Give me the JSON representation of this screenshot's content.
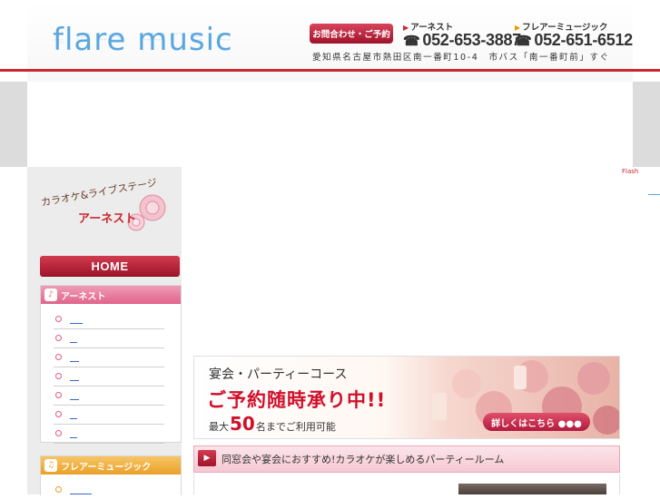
{
  "header": {
    "logo": "flare music",
    "contact_button": "お問合わせ・ご予約",
    "shops": [
      {
        "name": "アーネスト",
        "phone": "052-653-3887"
      },
      {
        "name": "フレアーミュージック",
        "phone": "052-651-6512"
      }
    ],
    "address": "愛知県名古屋市熱田区南一番町10-4　市バス「南一番町前」すぐ"
  },
  "sidebar": {
    "brand_tagline": "カラオケ&ライブステージ",
    "brand_name": "アーネスト",
    "home_button": "HOME",
    "sections": [
      {
        "title": "アーネスト",
        "item_count": 7
      },
      {
        "title": "フレアーミュージック",
        "item_count": 1
      }
    ]
  },
  "main": {
    "flash_notice": "Flash",
    "banner": {
      "title": "宴会・パーティーコース",
      "headline": "ご予約随時承り中!!",
      "capacity_prefix": "最大",
      "capacity_number": "50",
      "capacity_suffix": "名までご利用可能",
      "more_button": "詳しくはこちら ●●●"
    },
    "section_heading": "同窓会や宴会におすすめ!カラオケが楽しめるパーティールーム"
  },
  "colors": {
    "brand_red": "#c8282e",
    "logo_blue": "#5aa7e0",
    "pink_accent": "#e05a86",
    "orange_accent": "#f0a830"
  }
}
